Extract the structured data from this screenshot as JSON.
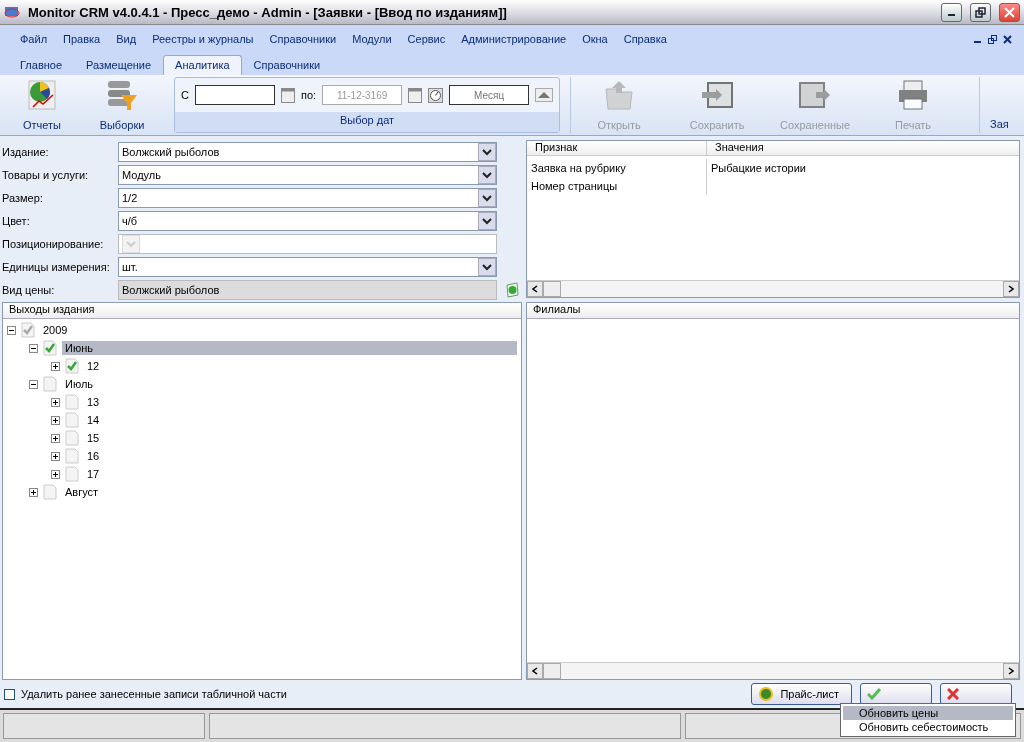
{
  "window": {
    "title": "Monitor CRM v4.0.4.1 - Пресс_демо - Admin - [Заявки - [Ввод по изданиям]]"
  },
  "menu": [
    "Файл",
    "Правка",
    "Вид",
    "Реестры и журналы",
    "Справочники",
    "Модули",
    "Сервис",
    "Администрирование",
    "Окна",
    "Справка"
  ],
  "tabs": [
    {
      "label": "Главное",
      "selected": false
    },
    {
      "label": "Размещение",
      "selected": false
    },
    {
      "label": "Аналитика",
      "selected": true
    },
    {
      "label": "Справочники",
      "selected": false
    }
  ],
  "ribbon": {
    "left_buttons": [
      {
        "kind": "reports",
        "label": "Отчеты",
        "disabled": false
      },
      {
        "kind": "filter",
        "label": "Выборки",
        "disabled": false
      }
    ],
    "dates": {
      "from_label": "С",
      "to_label": "по:",
      "to_value": "11-12-3169",
      "period_placeholder": "Месяц",
      "caption": "Выбор дат"
    },
    "right_buttons": [
      {
        "kind": "open",
        "label": "Открыть",
        "disabled": true
      },
      {
        "kind": "save",
        "label": "Сохранить",
        "disabled": true
      },
      {
        "kind": "saved",
        "label": "Сохраненные",
        "disabled": true
      },
      {
        "kind": "print",
        "label": "Печать",
        "disabled": true
      }
    ],
    "cut_label": "Зая"
  },
  "form": [
    {
      "label": "Издание:",
      "value": "Волжский рыболов",
      "kind": "dropdown",
      "disabled": false
    },
    {
      "label": "Товары и услуги:",
      "value": "Модуль",
      "kind": "dropdown",
      "disabled": false
    },
    {
      "label": "Размер:",
      "value": "1/2",
      "kind": "dropdown",
      "disabled": false
    },
    {
      "label": "Цвет:",
      "value": "ч/б",
      "kind": "dropdown",
      "disabled": false
    },
    {
      "label": "Позиционирование:",
      "kind": "dropdown",
      "disabled": true
    },
    {
      "label": "Единицы измерения:",
      "value": "шт.",
      "kind": "dropdown",
      "disabled": false
    },
    {
      "label": "Вид цены:",
      "value": "Волжский рыболов",
      "kind": "readonly",
      "disabled": true
    }
  ],
  "attributes": {
    "columns": [
      "Признак",
      "Значения"
    ],
    "rows": [
      [
        "Заявка на рубрику",
        "Рыбацкие истории"
      ],
      [
        "Номер страницы"
      ]
    ]
  },
  "issues": {
    "title": "Выходы издания",
    "tree": [
      {
        "label": "2009",
        "checked": true,
        "partial": true,
        "expanded": true,
        "selected": false,
        "children": [
          {
            "label": "Июнь",
            "checked": true,
            "partial": false,
            "expanded": true,
            "selected": true,
            "children": [
              {
                "label": "12",
                "checked": true,
                "partial": false,
                "expanded": false,
                "selected": false
              }
            ]
          },
          {
            "label": "Июль",
            "checked": false,
            "partial": false,
            "expanded": true,
            "selected": false,
            "children": [
              {
                "label": "13",
                "checked": false,
                "partial": false,
                "expanded": false,
                "selected": false
              },
              {
                "label": "14",
                "checked": false,
                "partial": false,
                "expanded": false,
                "selected": false
              },
              {
                "label": "15",
                "checked": false,
                "partial": false,
                "expanded": false,
                "selected": false
              },
              {
                "label": "16",
                "checked": false,
                "partial": false,
                "expanded": false,
                "selected": false
              },
              {
                "label": "17",
                "checked": false,
                "partial": false,
                "expanded": false,
                "selected": false
              }
            ]
          },
          {
            "label": "Август",
            "checked": false,
            "partial": false,
            "expanded": false,
            "selected": false
          }
        ]
      }
    ]
  },
  "branches": {
    "title": "Филиалы"
  },
  "footer": {
    "checkbox": {
      "label": "Удалить ранее занесенные записи табличной части",
      "checked": false
    },
    "price_button": "Прайс-лист"
  },
  "context_menu": [
    {
      "label": "Обновить цены",
      "selected": true
    },
    {
      "label": "Обновить себестоимость",
      "selected": false
    }
  ]
}
